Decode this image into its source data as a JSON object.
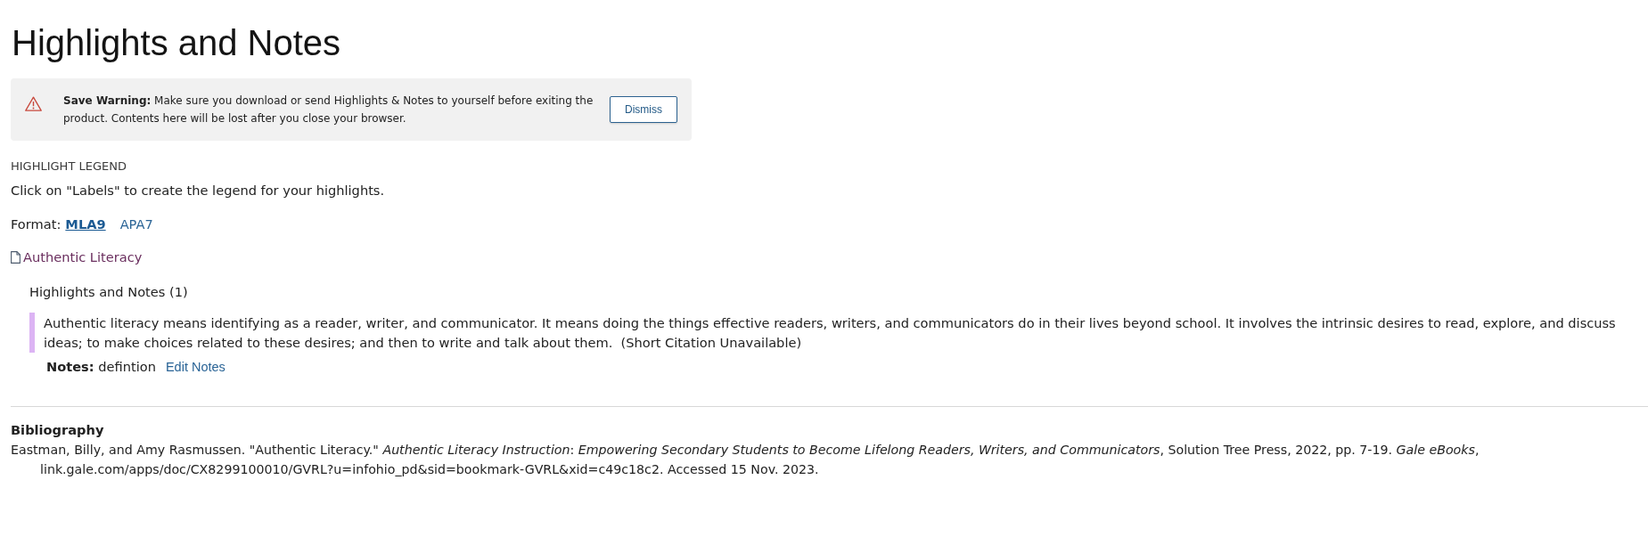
{
  "page": {
    "title": "Highlights and Notes"
  },
  "warning": {
    "message": "**Save Warning:** Make sure you download or send Highlights & Notes to yourself before exiting the product. Contents here will be lost after you close your browser.",
    "button": "Dismiss"
  },
  "legend": {
    "heading": "HIGHLIGHT LEGEND",
    "instruction": "Click on \"Labels\" to create the legend for your highlights."
  },
  "format": {
    "label": "Format:",
    "options": [
      {
        "label": "MLA9",
        "selected": true
      },
      {
        "label": "APA7",
        "selected": false
      }
    ]
  },
  "documents": [
    {
      "title": "Authentic Literacy",
      "section_heading": "Highlights and Notes (1)",
      "highlights": [
        {
          "color": "#dcb4f4",
          "text": "Authentic literacy means identifying as a reader, writer, and communicator. It means doing the things effective readers, writers, and communicators do in their lives beyond school. It involves the intrinsic desires to read, explore, and discuss ideas; to make choices related to these desires; and then to write and talk about them.  (Short Citation Unavailable)",
          "note": "**Notes:** defintion",
          "edit_link": "Edit Notes"
        }
      ]
    }
  ],
  "bibliography": {
    "heading": "Bibliography",
    "citation": "Eastman, Billy, and Amy Rasmussen. \"Authentic Literacy.\" *Authentic Literacy Instruction*: *Empowering Secondary Students to Become Lifelong Readers, Writers, and Communicators*, Solution Tree Press, 2022, pp. 7-19. *Gale eBooks*, link.gale.com/apps/doc/CX8299100010/GVRL?u=infohio_pd&sid=bookmark-GVRL&xid=c49c18c2. Accessed 15 Nov. 2023."
  }
}
